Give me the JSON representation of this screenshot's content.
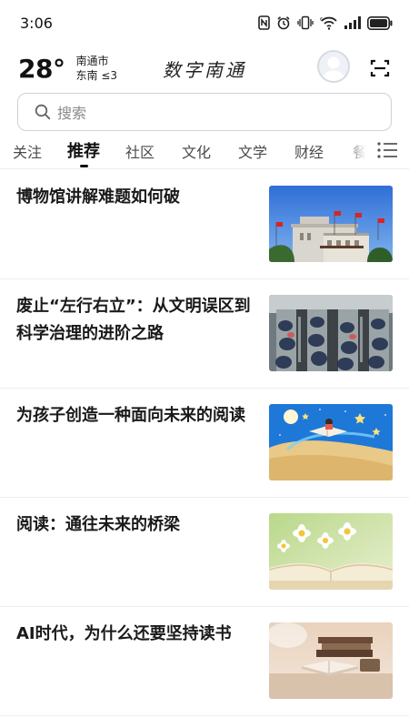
{
  "status_bar": {
    "time": "3:06",
    "icons": [
      "nfc-icon",
      "alarm-icon",
      "vibrate-icon",
      "wifi-icon",
      "signal-icon",
      "battery-icon"
    ]
  },
  "header": {
    "temperature": "28°",
    "city": "南通市",
    "wind": "东南 ≤3",
    "logo_text": "数字南通"
  },
  "search": {
    "placeholder": "搜索"
  },
  "tabs": [
    {
      "label": "关注",
      "active": false
    },
    {
      "label": "推荐",
      "active": true
    },
    {
      "label": "社区",
      "active": false
    },
    {
      "label": "文化",
      "active": false
    },
    {
      "label": "文学",
      "active": false
    },
    {
      "label": "财经",
      "active": false
    },
    {
      "label": "餐",
      "active": false
    }
  ],
  "feed": [
    {
      "title": "博物馆讲解难题如何破",
      "image": "museum-building"
    },
    {
      "title": "废止“左行右立”：从文明误区到科学治理的进阶之路",
      "image": "escalator-crowd"
    },
    {
      "title": "为孩子创造一种面向未来的阅读",
      "image": "child-reading-illustration"
    },
    {
      "title": "阅读：通往未来的桥梁",
      "image": "open-book-daisies"
    },
    {
      "title": "AI时代，为什么还要坚持读书",
      "image": "books-on-table"
    }
  ],
  "colors": {
    "accent": "#111111",
    "border": "#cfd2d6",
    "divider": "#ededed",
    "placeholder": "#8a8a8a"
  }
}
